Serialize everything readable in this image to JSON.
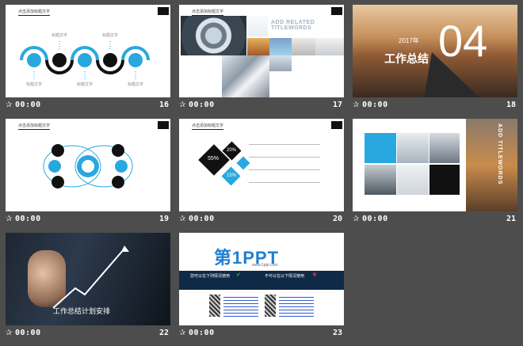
{
  "slides": [
    {
      "num": "16",
      "time": "00:00",
      "title": "点击添加标题文字",
      "items": [
        "标题文字",
        "标题文字",
        "标题文字",
        "标题文字",
        "标题文字"
      ]
    },
    {
      "num": "17",
      "time": "00:00",
      "title": "点击添加标题文字",
      "heading": "ADD RELATED TITLEWORDS"
    },
    {
      "num": "18",
      "time": "00:00",
      "big_number": "04",
      "caption": "工作总结",
      "year": "2017年"
    },
    {
      "num": "19",
      "time": "00:00",
      "title": "点击添加标题文字"
    },
    {
      "num": "20",
      "time": "00:00",
      "title": "点击添加标题文字",
      "pcts": [
        "55%",
        "20%",
        "15%"
      ]
    },
    {
      "num": "21",
      "time": "00:00",
      "vertical_text": "ADD TITLEWORDS"
    },
    {
      "num": "22",
      "time": "00:00",
      "caption": "工作总结计划安排"
    },
    {
      "num": "23",
      "time": "00:00",
      "logo": "第1PPT",
      "site": "www.1ppt.com",
      "left_head": "您可以在下列情况使用",
      "right_head": "不可以在以下情况使用"
    }
  ],
  "icons": {
    "play": "star-icon"
  }
}
